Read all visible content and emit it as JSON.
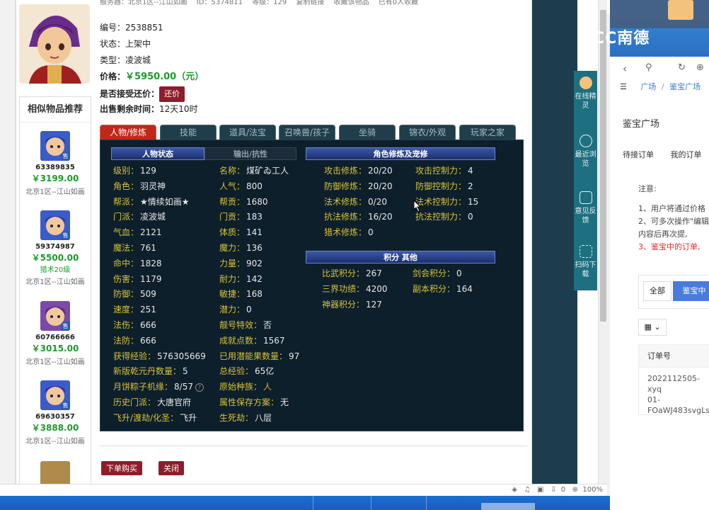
{
  "top_line": [
    "服务器：北京1区--江山如画",
    "ID：5374811",
    "等级：129",
    "复制链接",
    "收藏该物品",
    "已有0人收藏"
  ],
  "item": {
    "id_label": "编号：",
    "id_value": "2538851",
    "status_label": "状态：",
    "status_value": "上架中",
    "type_label": "类型：",
    "type_value": "凌波城",
    "price_label": "价格：",
    "price_value": "￥5950.00（元）",
    "counter_label": "是否接受还价：",
    "counter_btn": "还价",
    "time_label": "出售剩余时间：",
    "time_value": "12天10时"
  },
  "similar": {
    "title": "相似物品推荐",
    "badge": "售",
    "items": [
      {
        "id": "63389835",
        "price": "￥3199.00",
        "level": "",
        "server": "北京1区--江山如画"
      },
      {
        "id": "59374987",
        "price": "￥5500.00",
        "level": "猎术20级",
        "server": "北京1区--江山如画"
      },
      {
        "id": "60766666",
        "price": "￥3015.00",
        "level": "",
        "server": "北京1区--江山如画"
      },
      {
        "id": "69630357",
        "price": "￥3888.00",
        "level": "",
        "server": "北京1区--江山如画"
      }
    ]
  },
  "tabs": [
    "人物/修炼",
    "技能",
    "道具/法宝",
    "召唤兽/孩子",
    "坐骑",
    "锦衣/外观",
    "玩家之家"
  ],
  "panel": {
    "hdr_status": "人物状态",
    "hdr_output": "输出/抗性",
    "hdr_cultivation": "角色修炼及宠修",
    "hdr_points": "积分  其他",
    "col1": [
      {
        "k": "级别：",
        "v": "129"
      },
      {
        "k": "角色：",
        "v": "羽灵神"
      },
      {
        "k": "帮派：",
        "v": "★情续如画★"
      },
      {
        "k": "门派：",
        "v": "凌波城"
      },
      {
        "k": "气血：",
        "v": "2121"
      },
      {
        "k": "魔法：",
        "v": "761"
      },
      {
        "k": "命中：",
        "v": "1828"
      },
      {
        "k": "伤害：",
        "v": "1179"
      },
      {
        "k": "防御：",
        "v": "509"
      },
      {
        "k": "速度：",
        "v": "251"
      },
      {
        "k": "法伤：",
        "v": "666"
      },
      {
        "k": "法防：",
        "v": "666"
      },
      {
        "k": "获得经验：",
        "v": "576305669"
      },
      {
        "k": "新版乾元丹数量：",
        "v": "5"
      },
      {
        "k": "月饼粽子机缘：",
        "v": "8/57"
      },
      {
        "k": "历史门派：",
        "v": "大唐官府"
      },
      {
        "k": "飞升/渡劫/化圣：",
        "v": "飞升"
      }
    ],
    "col2": [
      {
        "k": "名称：",
        "v": "煤矿ゐ工人"
      },
      {
        "k": "人气：",
        "v": "800"
      },
      {
        "k": "帮贡：",
        "v": "1680"
      },
      {
        "k": "门贡：",
        "v": "183"
      },
      {
        "k": "体质：",
        "v": "141"
      },
      {
        "k": "魔力：",
        "v": "136"
      },
      {
        "k": "力量：",
        "v": "902"
      },
      {
        "k": "耐力：",
        "v": "142"
      },
      {
        "k": "敏捷：",
        "v": "168"
      },
      {
        "k": "潜力：",
        "v": "0"
      },
      {
        "k": "靓号特效：",
        "v": "否"
      },
      {
        "k": "成就点数：",
        "v": "1567"
      },
      {
        "k": "已用潜能果数量：",
        "v": "97"
      },
      {
        "k": "总经验：",
        "v": "65亿"
      },
      {
        "k": "原始种族：",
        "v": "人"
      },
      {
        "k": "属性保存方案：",
        "v": "无"
      },
      {
        "k": "生死劫：",
        "v": "八层"
      }
    ],
    "cult_left": [
      {
        "k": "攻击修炼：",
        "v": "20/20"
      },
      {
        "k": "防御修炼：",
        "v": "20/20"
      },
      {
        "k": "法术修炼：",
        "v": "0/20"
      },
      {
        "k": "抗法修炼：",
        "v": "16/20"
      },
      {
        "k": "猎术修炼：",
        "v": "0"
      }
    ],
    "cult_right": [
      {
        "k": "攻击控制力：",
        "v": "4"
      },
      {
        "k": "防御控制力：",
        "v": "2"
      },
      {
        "k": "法术控制力：",
        "v": "15"
      },
      {
        "k": "抗法控制力：",
        "v": "0"
      }
    ],
    "points_left": [
      {
        "k": "比武积分：",
        "v": "267"
      },
      {
        "k": "三界功绩：",
        "v": "4200"
      },
      {
        "k": "神器积分：",
        "v": "127"
      }
    ],
    "points_right": [
      {
        "k": "剑会积分：",
        "v": "0"
      },
      {
        "k": "副本积分：",
        "v": "164"
      }
    ]
  },
  "actions": {
    "buy": "下单购买",
    "close": "关闭"
  },
  "side_buttons": [
    {
      "label": "在线精灵",
      "icon": "sprite-icon"
    },
    {
      "label": "最近浏览",
      "icon": "clock-icon"
    },
    {
      "label": "意见反馈",
      "icon": "edit-icon"
    },
    {
      "label": "扫码下载",
      "icon": "scan-icon"
    }
  ],
  "statusbar": {
    "zoom": "100%",
    "count": "0"
  },
  "right": {
    "logo": "CC南德",
    "breadcrumb": [
      "广场",
      "鉴宝广场"
    ],
    "title": "鉴宝广场",
    "tabs": [
      "待接订单",
      "我的订单"
    ],
    "notice_title": "注意:",
    "notice_lines": [
      "1、用户将通过价格",
      "2、可多次操作\"编辑",
      "内容后再次提,"
    ],
    "notice_red": "3、鉴宝中的订单,",
    "filter_all": "全部",
    "filter_active": "鉴宝中",
    "th": "订单号",
    "td": [
      "2022112505-xyq",
      "01-",
      "FOaWJ483svgLs"
    ]
  },
  "colors": {
    "accent_red": "#8e1c2a",
    "price_green": "#1a9b2a",
    "panel_bg": "#0d1f2b",
    "label_gold": "#d6c23a"
  }
}
